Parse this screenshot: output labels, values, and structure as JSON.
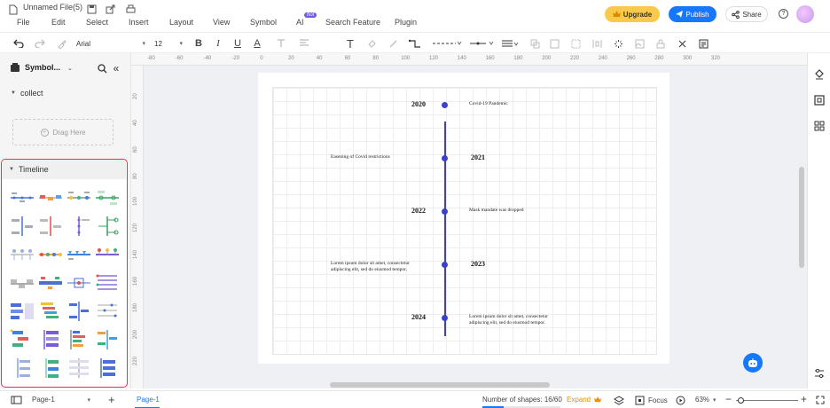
{
  "app": {
    "file_name": "Unnamed File(5)",
    "menus": [
      "File",
      "Edit",
      "Select",
      "Insert",
      "Layout",
      "View",
      "Symbol",
      "AI",
      "Search Feature",
      "Plugin"
    ],
    "ai_badge": "hot",
    "upgrade_label": "Upgrade",
    "publish_label": "Publish",
    "share_label": "Share",
    "help_label": "?"
  },
  "toolbar": {
    "font_family": "Arial",
    "font_size": "12",
    "bold": "B",
    "italic": "I",
    "underline": "U",
    "font_color": "A",
    "text_tool": "T"
  },
  "left_panel": {
    "title": "Symbol...",
    "sections": [
      {
        "label": "collect"
      },
      {
        "label": "Timeline"
      }
    ],
    "drag_here": "Drag Here"
  },
  "rulers": {
    "horizontal": [
      "-80",
      "-60",
      "-40",
      "-20",
      "0",
      "20",
      "40",
      "60",
      "80",
      "100",
      "120",
      "140",
      "160",
      "180",
      "200",
      "220",
      "240",
      "260",
      "280",
      "300",
      "320"
    ],
    "vertical": [
      "20",
      "40",
      "60",
      "80",
      "100",
      "120",
      "140",
      "160",
      "180",
      "200",
      "220"
    ]
  },
  "timeline": {
    "color": "#3d40c9",
    "entries": [
      {
        "year": "2020",
        "event": "Covid-19 Pandemic",
        "event_side": "right"
      },
      {
        "year": "2021",
        "event": "Easening of Covid restrictions",
        "event_side": "left"
      },
      {
        "year": "2022",
        "event": "Mask mandate was dropped",
        "event_side": "right"
      },
      {
        "year": "2023",
        "event": "Lorem ipsum dolor sit amet, consectetur adipiscing elit, sed do eiusmod tempor.",
        "event_side": "left"
      },
      {
        "year": "2024",
        "event": "Lorem ipsum dolor sit amet, consectetur adipiscing elit, sed do eiusmod tempor.",
        "event_side": "right"
      }
    ]
  },
  "statusbar": {
    "page_selector": "Page-1",
    "active_page": "Page-1",
    "shapes_count": "Number of shapes: 16/60",
    "expand_label": "Expand",
    "focus_label": "Focus",
    "zoom": "63%",
    "minus": "−",
    "plus": "+"
  },
  "colors": {
    "accent_blue": "#1677ff",
    "upgrade_yellow": "#f9c94b",
    "highlight_red": "#e0393e",
    "expand_orange": "#f08c00"
  }
}
